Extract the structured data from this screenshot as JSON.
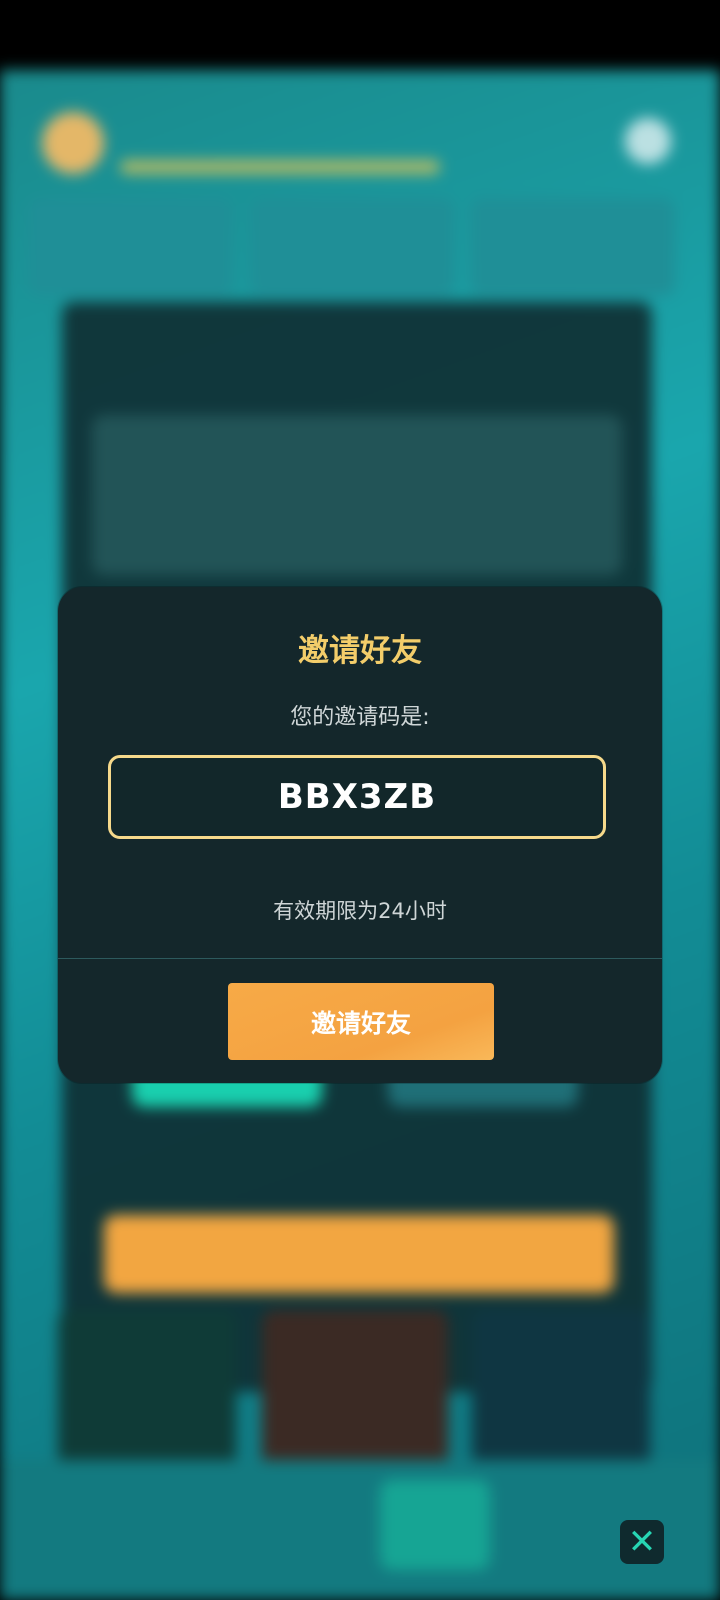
{
  "modal": {
    "title": "邀请好友",
    "code_label": "您的邀请码是:",
    "code": "BBX3ZB",
    "validity": "有效期限为24小时",
    "invite_button": "邀请好友"
  },
  "nav": {
    "close_icon": "close-icon"
  },
  "colors": {
    "title_gold": "#f3cd6a",
    "button_orange": "#f4a241",
    "modal_bg": "#14272b",
    "code_border": "#f6d98b"
  }
}
